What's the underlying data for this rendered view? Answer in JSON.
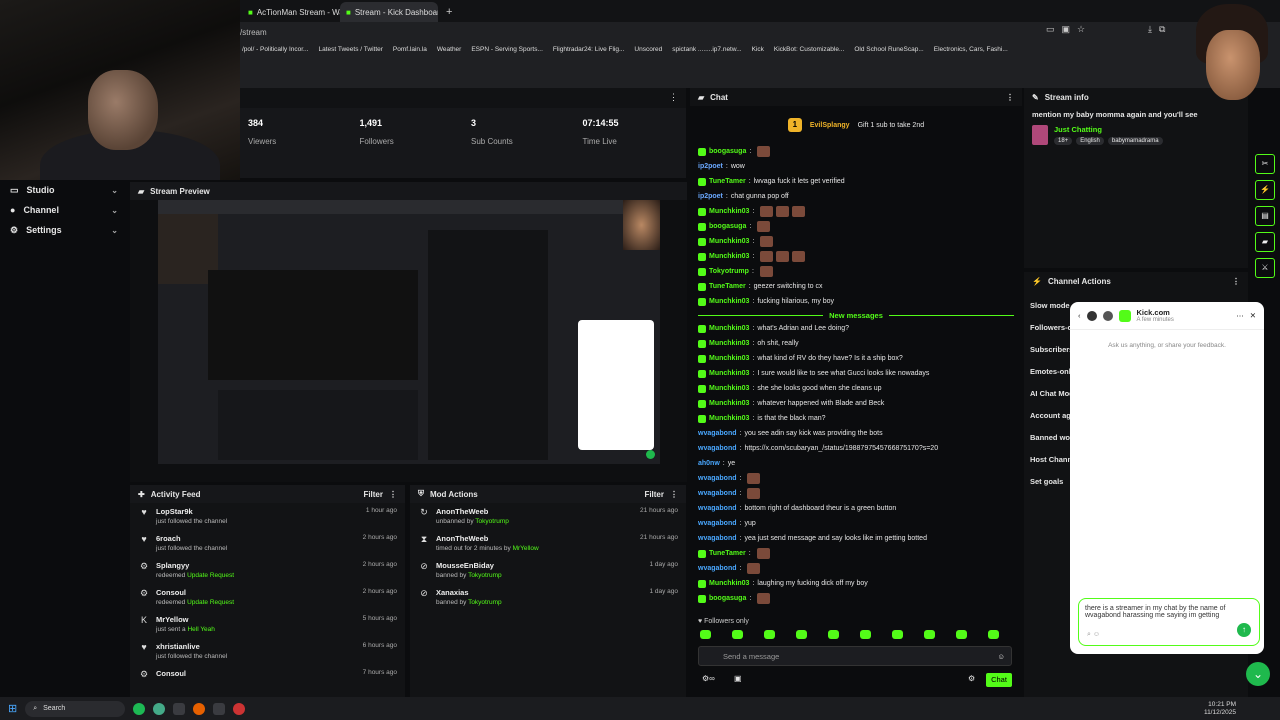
{
  "browser": {
    "tabs": [
      {
        "label": "AcTionMan Stream - Watch",
        "active": false
      },
      {
        "label": "Stream - Kick Dashboard",
        "active": true
      }
    ],
    "url_fragment": "/stream",
    "bookmarks": [
      "/pol/ - Politically Incor...",
      "Latest Tweets / Twitter",
      "Pomf.lain.la",
      "Weather",
      "ESPN - Serving Sports...",
      "Flightradar24: Live Flig...",
      "Unscored",
      "spictank ........ip7.netw...",
      "Kick",
      "KickBot: Customizable...",
      "Old School RuneScap...",
      "Electronics, Cars, Fashi..."
    ]
  },
  "sidebar": {
    "items": [
      {
        "label": "Studio",
        "icon": "monitor-icon"
      },
      {
        "label": "Channel",
        "icon": "user-icon"
      },
      {
        "label": "Settings",
        "icon": "gear-icon"
      }
    ]
  },
  "stats": [
    {
      "value": "384",
      "label": "Viewers"
    },
    {
      "value": "1,491",
      "label": "Followers"
    },
    {
      "value": "3",
      "label": "Sub Counts"
    },
    {
      "value": "07:14:55",
      "label": "Time Live"
    }
  ],
  "preview": {
    "title": "Stream Preview"
  },
  "activity_feed": {
    "title": "Activity Feed",
    "filter": "Filter",
    "items": [
      {
        "name": "LopStar9k",
        "sub": "just followed the channel",
        "action": "",
        "time": "1 hour ago",
        "icon": "heart-icon"
      },
      {
        "name": "6roach",
        "sub": "just followed the channel",
        "action": "",
        "time": "2 hours ago",
        "icon": "heart-icon"
      },
      {
        "name": "Splangyy",
        "sub": "redeemed ",
        "action": "Update Request",
        "time": "2 hours ago",
        "icon": "redeem-icon"
      },
      {
        "name": "Consoul",
        "sub": "redeemed ",
        "action": "Update Request",
        "time": "2 hours ago",
        "icon": "redeem-icon"
      },
      {
        "name": "MrYellow",
        "sub": "just sent a ",
        "action": "Hell Yeah",
        "time": "5 hours ago",
        "icon": "kick-icon"
      },
      {
        "name": "xhristianlive",
        "sub": "just followed the channel",
        "action": "",
        "time": "6 hours ago",
        "icon": "heart-icon"
      },
      {
        "name": "Consoul",
        "sub": "",
        "action": "",
        "time": "7 hours ago",
        "icon": "redeem-icon"
      }
    ]
  },
  "mod_actions": {
    "title": "Mod Actions",
    "filter": "Filter",
    "items": [
      {
        "name": "AnonTheWeeb",
        "sub": "unbanned by ",
        "by": "Tokyotrump",
        "time": "21 hours ago",
        "icon": "unban-icon"
      },
      {
        "name": "AnonTheWeeb",
        "sub": "timed out for 2 minutes by ",
        "by": "MrYellow",
        "time": "21 hours ago",
        "icon": "hourglass-icon"
      },
      {
        "name": "MousseEnBiday",
        "sub": "banned by ",
        "by": "Tokyotrump",
        "time": "1 day ago",
        "icon": "ban-icon"
      },
      {
        "name": "Xanaxias",
        "sub": "banned by ",
        "by": "Tokyotrump",
        "time": "1 day ago",
        "icon": "ban-icon"
      }
    ]
  },
  "chat": {
    "title": "Chat",
    "pinned_user": "EvilSplangy",
    "pinned_text": "Gift 1 sub to take 2nd",
    "new_messages": "New messages",
    "followers_only": "Followers only",
    "placeholder": "Send a message",
    "send_label": "Chat",
    "messages": [
      {
        "user": "boogasuga",
        "color": "#53fc18",
        "text": "",
        "emotes": 1
      },
      {
        "user": "ip2poet",
        "color": "#6aa8ff",
        "text": "wow",
        "emotes": 0
      },
      {
        "user": "TuneTamer",
        "color": "#53fc18",
        "text": "lwvaga fuck it lets get verified",
        "emotes": 0
      },
      {
        "user": "ip2poet",
        "color": "#6aa8ff",
        "text": "chat gunna pop off",
        "emotes": 0
      },
      {
        "user": "Munchkin03",
        "color": "#53fc18",
        "text": "",
        "emotes": 3
      },
      {
        "user": "boogasuga",
        "color": "#53fc18",
        "text": "",
        "emotes": 1
      },
      {
        "user": "Munchkin03",
        "color": "#53fc18",
        "text": "",
        "emotes": 1
      },
      {
        "user": "Munchkin03",
        "color": "#53fc18",
        "text": "",
        "emotes": 3
      },
      {
        "user": "Tokyotrump",
        "color": "#53fc18",
        "text": "",
        "emotes": 1
      },
      {
        "user": "TuneTamer",
        "color": "#53fc18",
        "text": "geezer switching to cx",
        "emotes": 0
      },
      {
        "user": "Munchkin03",
        "color": "#53fc18",
        "text": "fucking hilarious, my boy",
        "emotes": 0
      }
    ],
    "messages_new": [
      {
        "user": "Munchkin03",
        "color": "#53fc18",
        "text": "what's Adrian and Lee doing?",
        "emotes": 0
      },
      {
        "user": "Munchkin03",
        "color": "#53fc18",
        "text": "oh shit, really",
        "emotes": 0
      },
      {
        "user": "Munchkin03",
        "color": "#53fc18",
        "text": "what kind of RV do they have? Is it a ship box?",
        "emotes": 0
      },
      {
        "user": "Munchkin03",
        "color": "#53fc18",
        "text": "I sure would like to see what Gucci looks like nowadays",
        "emotes": 0
      },
      {
        "user": "Munchkin03",
        "color": "#53fc18",
        "text": "she she looks good when she cleans up",
        "emotes": 0
      },
      {
        "user": "Munchkin03",
        "color": "#53fc18",
        "text": "whatever happened with Blade and Beck",
        "emotes": 0
      },
      {
        "user": "Munchkin03",
        "color": "#53fc18",
        "text": "is that the black man?",
        "emotes": 0
      },
      {
        "user": "wvagabond",
        "color": "#4aa8ff",
        "text": "you see adin say kick was providing the bots",
        "emotes": 0
      },
      {
        "user": "wvagabond",
        "color": "#4aa8ff",
        "text": "https://x.com/scubaryan_/status/1988797545766875170?s=20",
        "emotes": 0
      },
      {
        "user": "ah0nw",
        "color": "#4aa8ff",
        "text": "ye",
        "emotes": 0
      },
      {
        "user": "wvagabond",
        "color": "#4aa8ff",
        "text": "",
        "emotes": 1
      },
      {
        "user": "wvagabond",
        "color": "#4aa8ff",
        "text": "",
        "emotes": 1
      },
      {
        "user": "wvagabond",
        "color": "#4aa8ff",
        "text": "bottom right of dashboard theur is a green button",
        "emotes": 0
      },
      {
        "user": "wvagabond",
        "color": "#4aa8ff",
        "text": "yup",
        "emotes": 0
      },
      {
        "user": "wvagabond",
        "color": "#4aa8ff",
        "text": "yea just send message and say looks like im getting botted",
        "emotes": 0
      },
      {
        "user": "TuneTamer",
        "color": "#53fc18",
        "text": "",
        "emotes": 1
      },
      {
        "user": "wvagabond",
        "color": "#4aa8ff",
        "text": "",
        "emotes": 1
      },
      {
        "user": "Munchkin03",
        "color": "#53fc18",
        "text": "laughing my fucking dick off my boy",
        "emotes": 0
      },
      {
        "user": "boogasuga",
        "color": "#53fc18",
        "text": "",
        "emotes": 1
      }
    ]
  },
  "stream_info": {
    "title": "Stream info",
    "stream_title": "mention my baby momma again and you'll see",
    "category": "Just Chatting",
    "tags": [
      "18+",
      "English",
      "babymamadrama"
    ]
  },
  "channel_actions": {
    "title": "Channel Actions",
    "items": [
      "Slow mode",
      "Followers-o",
      "Subscribers",
      "Emotes-only",
      "AI Chat Mod",
      "Account age",
      "Banned wor",
      "Host Chann",
      "Set goals"
    ]
  },
  "kick_support": {
    "name": "Kick.com",
    "status": "A few minutes",
    "hint": "Ask us anything, or share your feedback.",
    "draft": "there is a streamer in my chat by the name of wvagabond harassing me saying im getting"
  },
  "taskbar": {
    "search": "Search",
    "time": "10:21 PM",
    "date": "11/12/2025"
  }
}
